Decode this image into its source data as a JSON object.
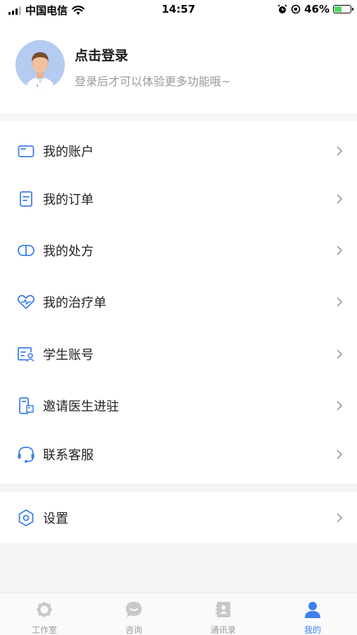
{
  "status_bar": {
    "carrier": "中国电信",
    "time": "14:57",
    "battery": "46%",
    "battery_level": 0.46
  },
  "profile": {
    "title": "点击登录",
    "subtitle": "登录后才可以体验更多功能哦~",
    "avatar_icon": "doctor-avatar-icon"
  },
  "menu": {
    "items": [
      {
        "label": "我的账户",
        "icon": "wallet-icon"
      },
      {
        "label": "我的订单",
        "icon": "order-icon"
      },
      {
        "label": "我的处方",
        "icon": "pill-icon"
      },
      {
        "label": "我的治疗单",
        "icon": "heart-pulse-icon"
      },
      {
        "label": "学生账号",
        "icon": "student-card-icon"
      },
      {
        "label": "邀请医生进驻",
        "icon": "invite-doctor-icon"
      },
      {
        "label": "联系客服",
        "icon": "headset-icon"
      }
    ],
    "settings": {
      "label": "设置",
      "icon": "settings-hexagon-icon"
    }
  },
  "tabbar": {
    "tabs": [
      {
        "label": "工作室",
        "icon": "studio-icon",
        "active": false
      },
      {
        "label": "咨询",
        "icon": "chat-icon",
        "active": false
      },
      {
        "label": "通讯录",
        "icon": "contacts-icon",
        "active": false
      },
      {
        "label": "我的",
        "icon": "user-icon",
        "active": true
      }
    ]
  },
  "colors": {
    "accent": "#3b82f0",
    "icon_blue": "#3f7ee8",
    "text_primary": "#222222",
    "text_secondary": "#999999",
    "tab_inactive": "#9a9a9a",
    "background": "#f4f5f7"
  }
}
